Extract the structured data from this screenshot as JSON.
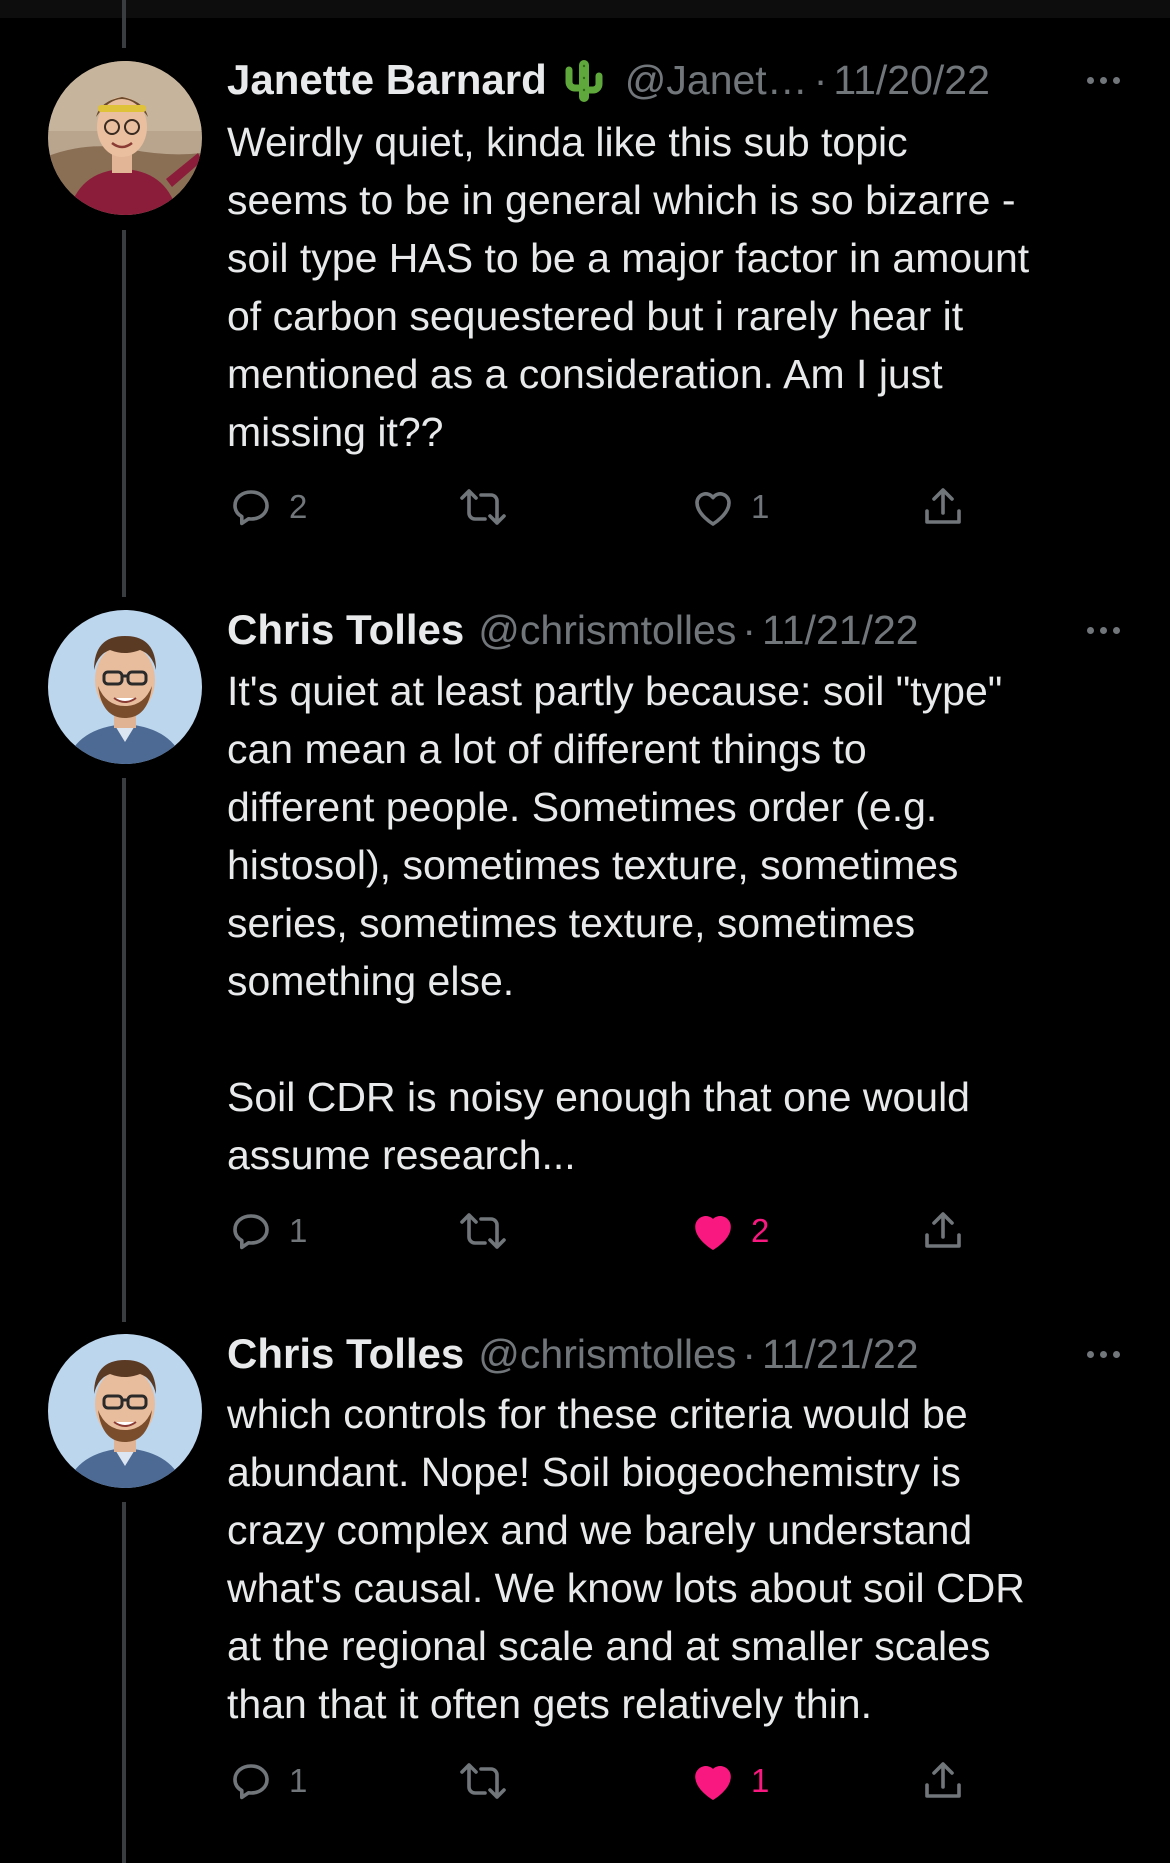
{
  "colors": {
    "background": "#000000",
    "primary_text": "#e7e9ea",
    "secondary_text": "#71767b",
    "like_active": "#f91880",
    "thread_line": "#3a3d40"
  },
  "tweets": [
    {
      "name": "Janette Barnard",
      "name_emoji": "cactus",
      "handle": "@Janet…",
      "separator": "·",
      "date": "11/20/22",
      "text": "Weirdly quiet, kinda like this sub topic\nseems to be in general which is so bizarre -\nsoil type HAS to be a major factor in amount\nof carbon sequestered but i rarely hear it\nmentioned as a consideration. Am I just\nmissing it??",
      "replies": "2",
      "retweets": "",
      "likes": "1",
      "liked": false
    },
    {
      "name": "Chris Tolles",
      "handle": "@chrismtolles",
      "separator": "·",
      "date": "11/21/22",
      "text": "It's quiet at least partly because: soil \"type\"\ncan mean a lot of different things to\ndifferent people. Sometimes order (e.g.\nhistosol), sometimes texture, sometimes\nseries, sometimes texture, sometimes\nsomething else.\n\nSoil CDR is noisy enough that one would\nassume research...",
      "replies": "1",
      "retweets": "",
      "likes": "2",
      "liked": true
    },
    {
      "name": "Chris Tolles",
      "handle": "@chrismtolles",
      "separator": "·",
      "date": "11/21/22",
      "text": "which controls for these criteria would be\nabundant. Nope! Soil biogeochemistry is\ncrazy complex and we barely understand\nwhat's causal. We know lots about soil CDR\nat the regional scale and at smaller scales\nthan that it often gets relatively thin.",
      "replies": "1",
      "retweets": "",
      "likes": "1",
      "liked": true
    }
  ]
}
